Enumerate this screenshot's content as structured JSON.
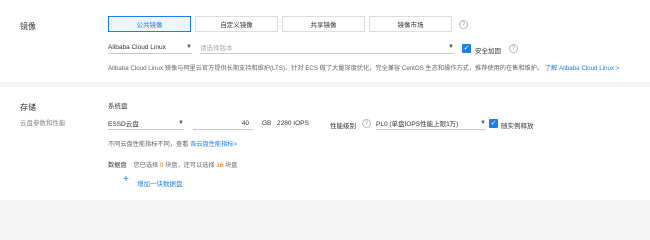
{
  "image": {
    "section_label": "镜像",
    "tabs": [
      {
        "label": "公共镜像"
      },
      {
        "label": "自定义镜像"
      },
      {
        "label": "共享镜像"
      },
      {
        "label": "镜像市场"
      }
    ],
    "tab_help": "?",
    "os_select": "Alibaba Cloud Linux",
    "version_placeholder": "请选择版本",
    "security_hardening": "安全加固",
    "security_help": "?",
    "description": "Alibaba Cloud Linux 镜像与阿里云官方提供长期支持和维护(LTS)，针对 ECS 做了大量深度优化，完全兼容 CentOS 生态和操作方式，推荐使用的在售和维护。",
    "description_link": "了解 Alibaba Cloud Linux >"
  },
  "storage": {
    "section_label": "存储",
    "section_sub": "云盘参数和性能",
    "system_disk_label": "系统盘",
    "disk_type": "ESSD云盘",
    "size_value": "40",
    "size_unit": "GB",
    "iops": "2280 IOPS",
    "performance_label": "性能级别",
    "performance_help": "?",
    "performance_select": "PL0 (单盘IOPS性能上限1万)",
    "release_with_instance": "随实例释放",
    "perf_hint_prefix": "不同云盘性能指标不同，查看",
    "perf_hint_link": "各云盘性能指标>",
    "data_disk_label": "数据盘",
    "data_disk_prefix": "您已选择",
    "data_disk_selected": "0",
    "data_disk_middle": "块盘，还可以选择",
    "data_disk_remaining": "16",
    "data_disk_suffix": "块盘",
    "add_disk": "增加一块数据盘"
  },
  "colors": {
    "accent": "#1d7fe6",
    "warning": "#ff6600"
  }
}
